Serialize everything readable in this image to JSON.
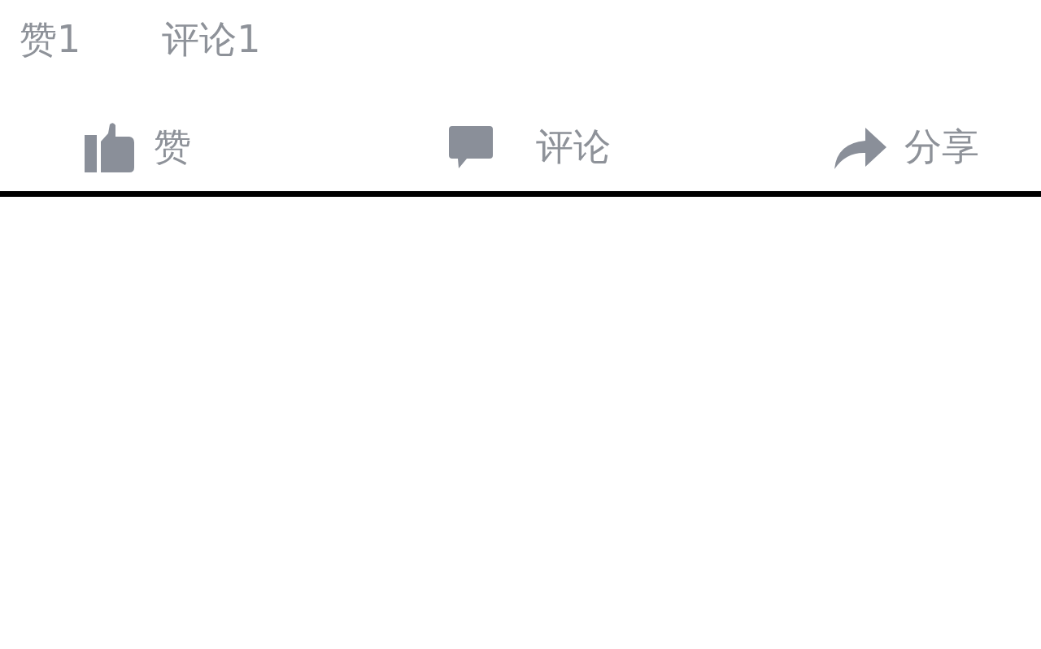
{
  "stats": [
    "赞1",
    "评论1"
  ],
  "actions": [
    {
      "kind": "like",
      "label": "赞"
    },
    {
      "kind": "comment",
      "label": "评论"
    },
    {
      "kind": "share",
      "label": "分享"
    }
  ]
}
